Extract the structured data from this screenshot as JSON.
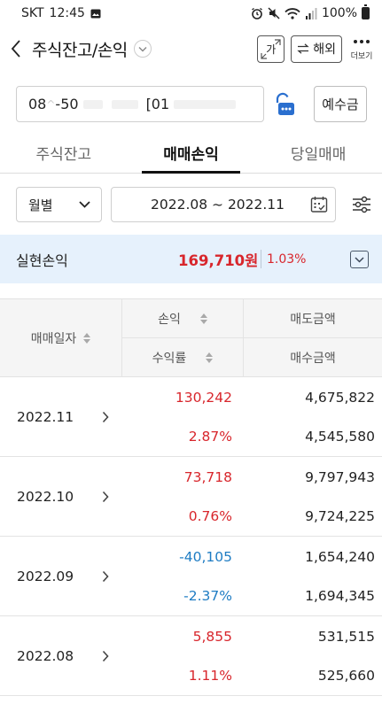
{
  "status_bar": {
    "carrier": "SKT",
    "time": "12:45",
    "battery": "100%"
  },
  "header": {
    "title": "주식잔고/손익",
    "font_button_label": "가",
    "overseas_label": "해외",
    "more_label": "더보기"
  },
  "account": {
    "number_prefix": "08",
    "number_part": "-50",
    "number_part2": "[01",
    "deposit_label": "예수금"
  },
  "tabs": [
    {
      "label": "주식잔고",
      "active": false
    },
    {
      "label": "매매손익",
      "active": true
    },
    {
      "label": "당일매매",
      "active": false
    }
  ],
  "filter": {
    "period_label": "월별",
    "date_range": "2022.08 ~ 2022.11"
  },
  "summary": {
    "label": "실현손익",
    "amount": "169,710원",
    "rate": "1.03%"
  },
  "table": {
    "headers": {
      "date": "매매일자",
      "profit_loss": "손익",
      "return_rate": "수익률",
      "sell_amount": "매도금액",
      "buy_amount": "매수금액"
    },
    "rows": [
      {
        "date": "2022.11",
        "profit_loss": "130,242",
        "return_rate": "2.87%",
        "sell_amount": "4,675,822",
        "buy_amount": "4,545,580",
        "sign": "pos"
      },
      {
        "date": "2022.10",
        "profit_loss": "73,718",
        "return_rate": "0.76%",
        "sell_amount": "9,797,943",
        "buy_amount": "9,724,225",
        "sign": "pos"
      },
      {
        "date": "2022.09",
        "profit_loss": "-40,105",
        "return_rate": "-2.37%",
        "sell_amount": "1,654,240",
        "buy_amount": "1,694,345",
        "sign": "neg"
      },
      {
        "date": "2022.08",
        "profit_loss": "5,855",
        "return_rate": "1.11%",
        "sell_amount": "531,515",
        "buy_amount": "525,660",
        "sign": "pos"
      }
    ]
  },
  "colors": {
    "profit": "#d8262c",
    "loss": "#1e7cc3",
    "summary_bg": "#e6f1fc"
  }
}
